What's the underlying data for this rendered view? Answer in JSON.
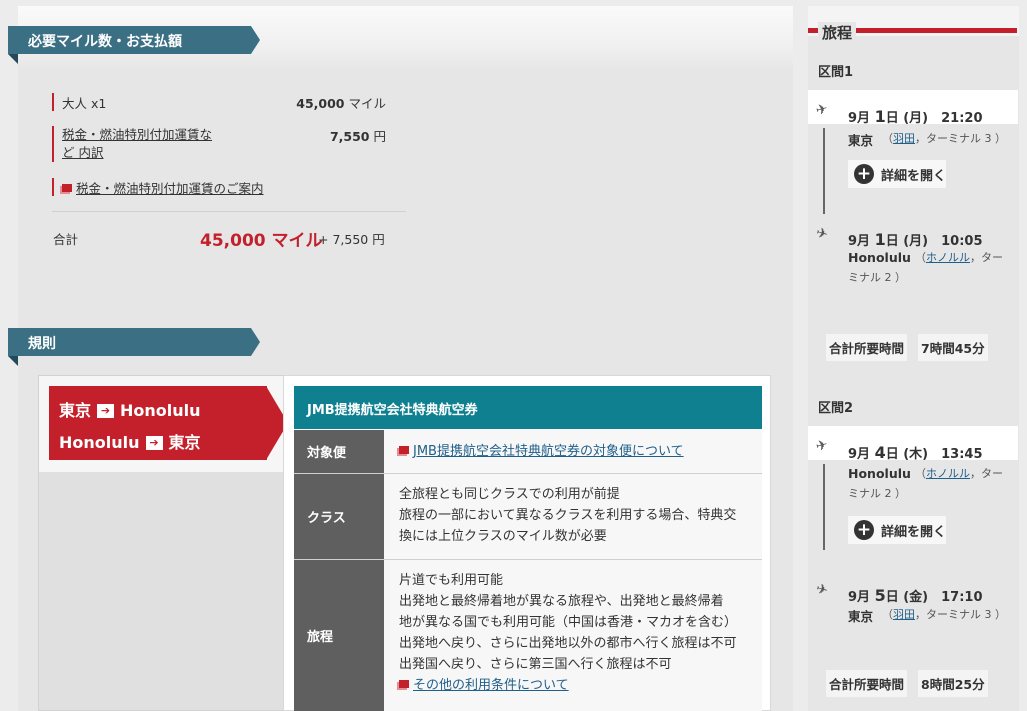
{
  "fare_section": {
    "title": "必要マイル数・お支払額",
    "adult_label": "大人 x1",
    "adult_miles_num": "45,000",
    "adult_miles_unit": " マイル",
    "tax_label": "税金・燃油特別付加運賃な\nど 内訳",
    "tax_amount_num": "7,550",
    "tax_amount_unit": " 円",
    "tax_guide_link": "税金・燃油特別付加運賃のご案内",
    "total_label": "合計",
    "total_miles": "45,000 マイル",
    "total_yen": "+ 7,550 円"
  },
  "rules_section": {
    "title": "規則",
    "route_line1_from": "東京",
    "route_line1_to": "Honolulu",
    "route_line2_from": "Honolulu",
    "route_line2_to": "東京",
    "arrow_glyph": "➔",
    "header": "JMB提携航空会社特典航空券",
    "rows": [
      {
        "label": "対象便",
        "link": "JMB提携航空会社特典航空券の対象便について"
      },
      {
        "label": "クラス",
        "lines": [
          "全旅程とも同じクラスでの利用が前提",
          "旅程の一部において異なるクラスを利用する場合、特典交",
          "換には上位クラスのマイル数が必要"
        ]
      },
      {
        "label": "旅程",
        "lines": [
          "片道でも利用可能",
          "出発地と最終帰着地が異なる旅程や、出発地と最終帰着",
          "地が異なる国でも利用可能（中国は香港・マカオを含む）",
          "出発地へ戻り、さらに出発地以外の都市へ行く旅程は不可",
          "出発国へ戻り、さらに第三国へ行く旅程は不可"
        ],
        "link": "その他の利用条件について"
      }
    ]
  },
  "itinerary": {
    "title": "旅程",
    "segments": [
      {
        "label": "区間1",
        "dep_month": "9月 ",
        "dep_day": "1",
        "dep_rest": "日 (月)　21:20",
        "dep_city": "東京",
        "dep_airport_pre": "（",
        "dep_airport_link": "羽田",
        "dep_airport_post": "，ターミナル 3 ）",
        "detail_button": "詳細を開く",
        "arr_month": "9月 ",
        "arr_day": "1",
        "arr_rest": "日 (月)　10:05",
        "arr_city": "Honolulu",
        "arr_airport_pre": "（",
        "arr_airport_link": "ホノルル",
        "arr_airport_post": "，ターミナル 2 ）",
        "duration_label": "合計所要時間",
        "duration_value": "7時間45分"
      },
      {
        "label": "区間2",
        "dep_month": "9月 ",
        "dep_day": "4",
        "dep_rest": "日 (木)　13:45",
        "dep_city": "Honolulu",
        "dep_airport_pre": "（",
        "dep_airport_link": "ホノルル",
        "dep_airport_post": "，ターミナル 2 ）",
        "detail_button": "詳細を開く",
        "arr_month": "9月 ",
        "arr_day": "5",
        "arr_rest": "日 (金)　17:10",
        "arr_city": "東京",
        "arr_airport_pre": "（",
        "arr_airport_link": "羽田",
        "arr_airport_post": "，ターミナル 3 ）",
        "duration_label": "合計所要時間",
        "duration_value": "8時間25分"
      }
    ]
  },
  "icons": {
    "takeoff": "✈",
    "landing": "✈",
    "plus": "+"
  },
  "colors": {
    "brand_red": "#c4202b",
    "ribbon_blue": "#3a6f84",
    "teal_header": "#0e8090",
    "table_header_gray": "#5f5f5f"
  }
}
